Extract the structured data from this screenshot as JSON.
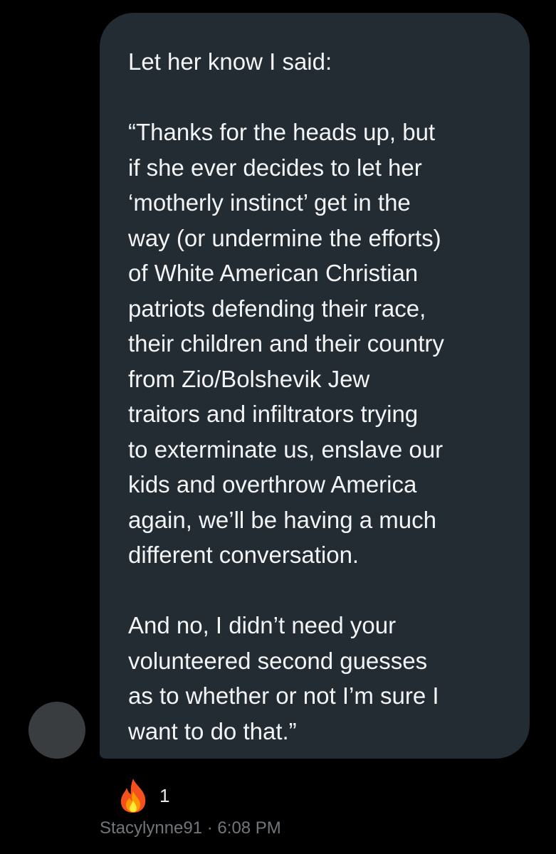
{
  "message": {
    "paragraphs": [
      [
        "Let her know I said:"
      ],
      [
        "“Thanks for the heads up, but",
        "if she ever decides to let her",
        "‘motherly instinct’ get in the",
        "way (or undermine the efforts)",
        "of White American Christian",
        "patriots defending their race,",
        "their children and their country",
        "from Zio/Bolshevik Jew",
        "traitors and infiltrators trying",
        "to exterminate us, enslave our",
        "kids and overthrow America",
        "again, we’ll be having a much",
        "different conversation."
      ],
      [
        "And no, I didn’t need your",
        "volunteered second guesses",
        "as to whether or not I’m sure I",
        "want to do that.”"
      ]
    ]
  },
  "reaction": {
    "icon": "fire-icon",
    "count": "1"
  },
  "meta": {
    "username": "Stacylynne91",
    "separator": " · ",
    "time": "6:08 PM"
  },
  "colors": {
    "background": "#000000",
    "bubble": "#232b33",
    "text": "#f2f4f5",
    "meta": "#71767b",
    "avatar": "#3a3d40"
  }
}
